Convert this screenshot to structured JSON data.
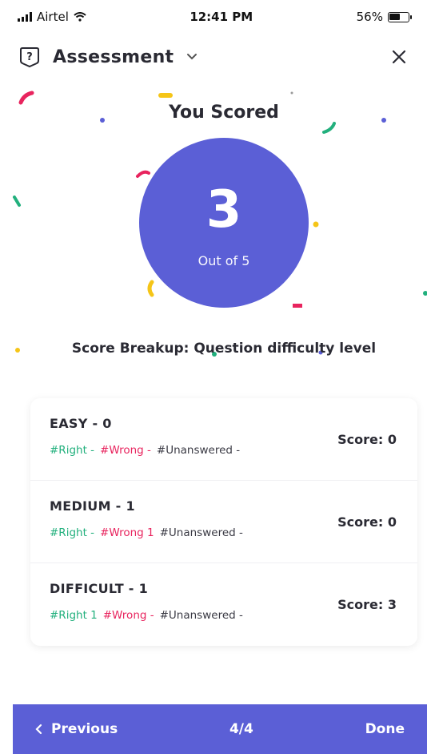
{
  "status_bar": {
    "carrier": "Airtel",
    "time": "12:41 PM",
    "battery": "56%"
  },
  "header": {
    "title": "Assessment",
    "icons": [
      "help-icon",
      "chevron-down-icon",
      "close-icon"
    ]
  },
  "result": {
    "heading": "You Scored",
    "score": "3",
    "total_label": "Out of 5"
  },
  "breakup": {
    "title": "Score Breakup: Question difficulty level",
    "levels": [
      {
        "title": "EASY - 0",
        "right": "#Right -",
        "wrong": "#Wrong -",
        "unanswered": "#Unanswered -",
        "score": "Score: 0"
      },
      {
        "title": "MEDIUM - 1",
        "right": "#Right -",
        "wrong": "#Wrong 1",
        "unanswered": "#Unanswered -",
        "score": "Score: 0"
      },
      {
        "title": "DIFFICULT - 1",
        "right": "#Right 1",
        "wrong": "#Wrong -",
        "unanswered": "#Unanswered -",
        "score": "Score: 3"
      }
    ]
  },
  "footer": {
    "previous_label": "Previous",
    "page_indicator": "4/4",
    "done_label": "Done"
  },
  "colors": {
    "accent": "#5b5fd6",
    "right": "#22b07d",
    "wrong": "#e8245e"
  }
}
